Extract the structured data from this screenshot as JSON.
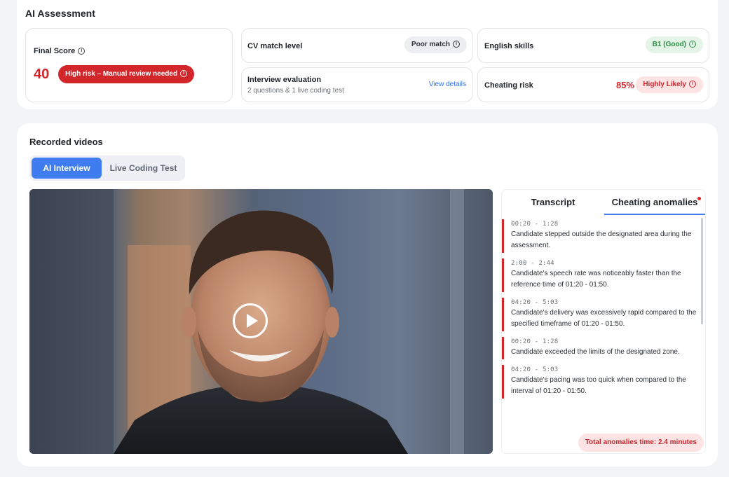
{
  "assessment": {
    "title": "AI Assessment",
    "final_score": {
      "label": "Final Score",
      "value": "40",
      "badge": "High risk – Manual review needed"
    },
    "cv_match": {
      "label": "CV match level",
      "badge": "Poor match"
    },
    "english": {
      "label": "English skills",
      "badge": "B1 (Good)"
    },
    "interview": {
      "label": "Interview evaluation",
      "sub": "2 questions & 1 live coding test",
      "link": "View details"
    },
    "cheating": {
      "label": "Cheating risk",
      "percent": "85%",
      "badge": "Highly Likely"
    }
  },
  "videos": {
    "title": "Recorded videos",
    "tabs": [
      "AI Interview",
      "Live Coding Test"
    ],
    "active_tab": 0
  },
  "side": {
    "tabs": [
      "Transcript",
      "Cheating anomalies"
    ],
    "active_tab": 1,
    "anomalies": [
      {
        "time": "00:20 - 1:28",
        "text": "Candidate stepped outside the designated area during the assessment."
      },
      {
        "time": "2:00 - 2:44",
        "text": "Candidate's speech rate was noticeably faster than the reference time of 01:20 - 01:50."
      },
      {
        "time": "04:20 - 5:03",
        "text": "Candidate's delivery was excessively rapid compared to the specified timeframe of 01:20 - 01:50."
      },
      {
        "time": "00:20 - 1:28",
        "text": "Candidate exceeded the limits of the designated zone."
      },
      {
        "time": "04:20 - 5:03",
        "text": "Candidate's pacing was too quick when compared to the interval of 01:20 - 01:50."
      }
    ],
    "total": "Total anomalies time: 2.4 minutes"
  },
  "colors": {
    "accent": "#3f7cf0",
    "danger": "#d3262b",
    "success": "#2e8b45"
  },
  "icons": {
    "info": "info-icon",
    "play": "play-icon",
    "notification_dot": "notification-dot"
  }
}
